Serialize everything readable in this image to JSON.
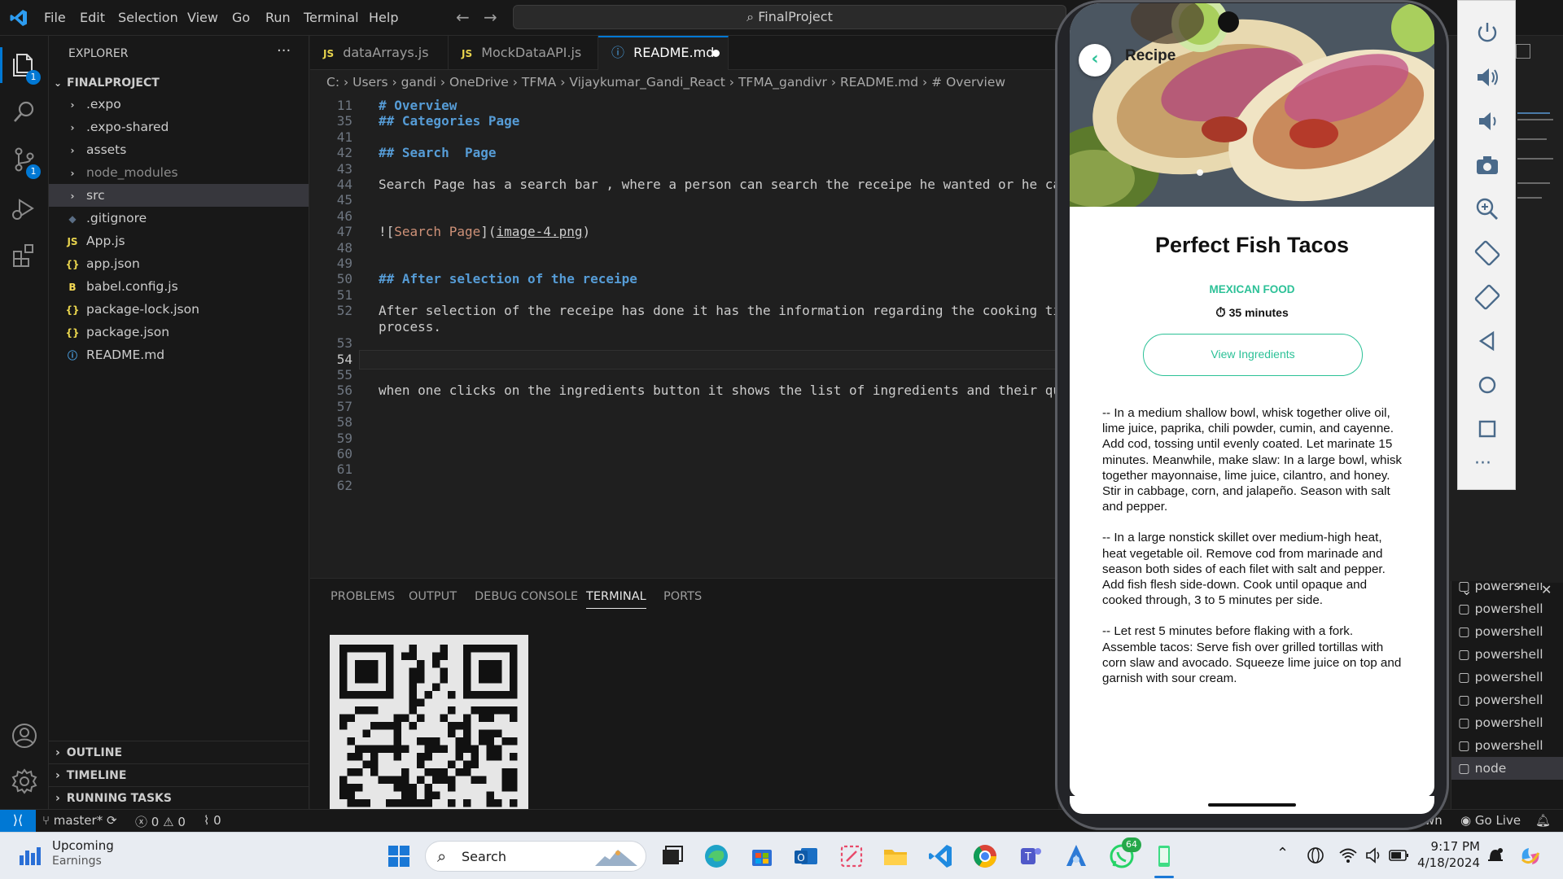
{
  "titlebar": {
    "menu": [
      "File",
      "Edit",
      "Selection",
      "View",
      "Go",
      "Run",
      "Terminal",
      "Help"
    ],
    "search": "FinalProject"
  },
  "activity": {
    "explorer_badge": "1",
    "scm_badge": "1"
  },
  "explorer": {
    "header": "EXPLORER",
    "project": "FINALPROJECT",
    "items": [
      {
        "label": ".expo",
        "kind": "folder"
      },
      {
        "label": ".expo-shared",
        "kind": "folder"
      },
      {
        "label": "assets",
        "kind": "folder"
      },
      {
        "label": "node_modules",
        "kind": "folder"
      },
      {
        "label": "src",
        "kind": "folder"
      },
      {
        "label": ".gitignore",
        "kind": "file"
      },
      {
        "label": "App.js",
        "kind": "js"
      },
      {
        "label": "app.json",
        "kind": "json"
      },
      {
        "label": "babel.config.js",
        "kind": "babel"
      },
      {
        "label": "package-lock.json",
        "kind": "json"
      },
      {
        "label": "package.json",
        "kind": "json"
      },
      {
        "label": "README.md",
        "kind": "info"
      }
    ],
    "sections": [
      "OUTLINE",
      "TIMELINE",
      "RUNNING TASKS"
    ]
  },
  "tabs": [
    {
      "label": "dataArrays.js",
      "icon": "JS"
    },
    {
      "label": "MockDataAPI.js",
      "icon": "JS"
    },
    {
      "label": "README.md",
      "icon": "ⓘ"
    }
  ],
  "breadcrumb": [
    "C:",
    "Users",
    "gandi",
    "OneDrive",
    "TFMA",
    "Vijaykumar_Gandi_React",
    "TFMA_gandivr",
    "README.md",
    "# Overview"
  ],
  "editor": {
    "lines": [
      {
        "n": "11",
        "text": "# Overview",
        "style": "hd"
      },
      {
        "n": "35",
        "text": "## Categories Page",
        "style": "hd"
      },
      {
        "n": "41",
        "text": "",
        "style": ""
      },
      {
        "n": "42",
        "text": "## Search  Page",
        "style": "hd"
      },
      {
        "n": "43",
        "text": "",
        "style": ""
      },
      {
        "n": "44",
        "text": "Search Page has a search bar , where a person can search the receipe he wanted or he can",
        "style": ""
      },
      {
        "n": "45",
        "text": "",
        "style": ""
      },
      {
        "n": "46",
        "text": "",
        "style": ""
      },
      {
        "n": "47",
        "text": "![Search Page](image-4.png)",
        "style": "lk"
      },
      {
        "n": "48",
        "text": "",
        "style": ""
      },
      {
        "n": "49",
        "text": "",
        "style": ""
      },
      {
        "n": "50",
        "text": "## After selection of the receipe",
        "style": "hd"
      },
      {
        "n": "51",
        "text": "",
        "style": ""
      },
      {
        "n": "52",
        "text": "After selection of the receipe has done it has the information regarding the cooking time",
        "style": ""
      },
      {
        "n": "",
        "text": "process.",
        "style": ""
      },
      {
        "n": "53",
        "text": "",
        "style": ""
      },
      {
        "n": "54",
        "text": "",
        "style": "cur"
      },
      {
        "n": "55",
        "text": "",
        "style": ""
      },
      {
        "n": "56",
        "text": "when one clicks on the ingredients button it shows the list of ingredients and their quant",
        "style": ""
      },
      {
        "n": "57",
        "text": "",
        "style": ""
      },
      {
        "n": "58",
        "text": "",
        "style": ""
      },
      {
        "n": "59",
        "text": "",
        "style": ""
      },
      {
        "n": "60",
        "text": "",
        "style": ""
      },
      {
        "n": "61",
        "text": "",
        "style": ""
      },
      {
        "n": "62",
        "text": "",
        "style": ""
      }
    ]
  },
  "panel": {
    "tabs": [
      "PROBLEMS",
      "OUTPUT",
      "DEBUG CONSOLE",
      "TERMINAL",
      "PORTS"
    ],
    "terminals": [
      "powershell",
      "powershell",
      "powershell",
      "powershell",
      "powershell",
      "powershell",
      "powershell",
      "powershell",
      "node"
    ]
  },
  "statusbar": {
    "branch": "master*",
    "errors": "0",
    "warnings": "0",
    "ports": "0",
    "right_partial": "wn",
    "golive": "Go Live"
  },
  "app": {
    "header": "Recipe",
    "title": "Perfect Fish Tacos",
    "category": "MEXICAN FOOD",
    "time": "35 minutes",
    "button": "View Ingredients",
    "paragraphs": [
      "-- In a medium shallow bowl, whisk together olive oil, lime juice, paprika, chili powder, cumin, and cayenne. Add cod, tossing until evenly coated. Let marinate 15 minutes. Meanwhile, make slaw: In a large bowl, whisk together mayonnaise, lime juice, cilantro, and honey. Stir in cabbage, corn, and jalapeño. Season with salt and pepper.",
      " -- In a large nonstick skillet over medium-high heat, heat vegetable oil. Remove cod from marinade and season both sides of each filet with salt and pepper. Add fish flesh side-down. Cook until opaque and cooked through, 3 to 5 minutes per side.",
      " -- Let rest 5 minutes before flaking with a fork. Assemble tacos: Serve fish over grilled tortillas with corn slaw and avocado. Squeeze lime juice on top and garnish with sour cream."
    ],
    "accent": "#2cc197"
  },
  "taskbar": {
    "weather_title": "Upcoming",
    "weather_sub": "Earnings",
    "search": "Search",
    "whatsapp_badge": "64",
    "time": "9:17 PM",
    "date": "4/18/2024"
  }
}
